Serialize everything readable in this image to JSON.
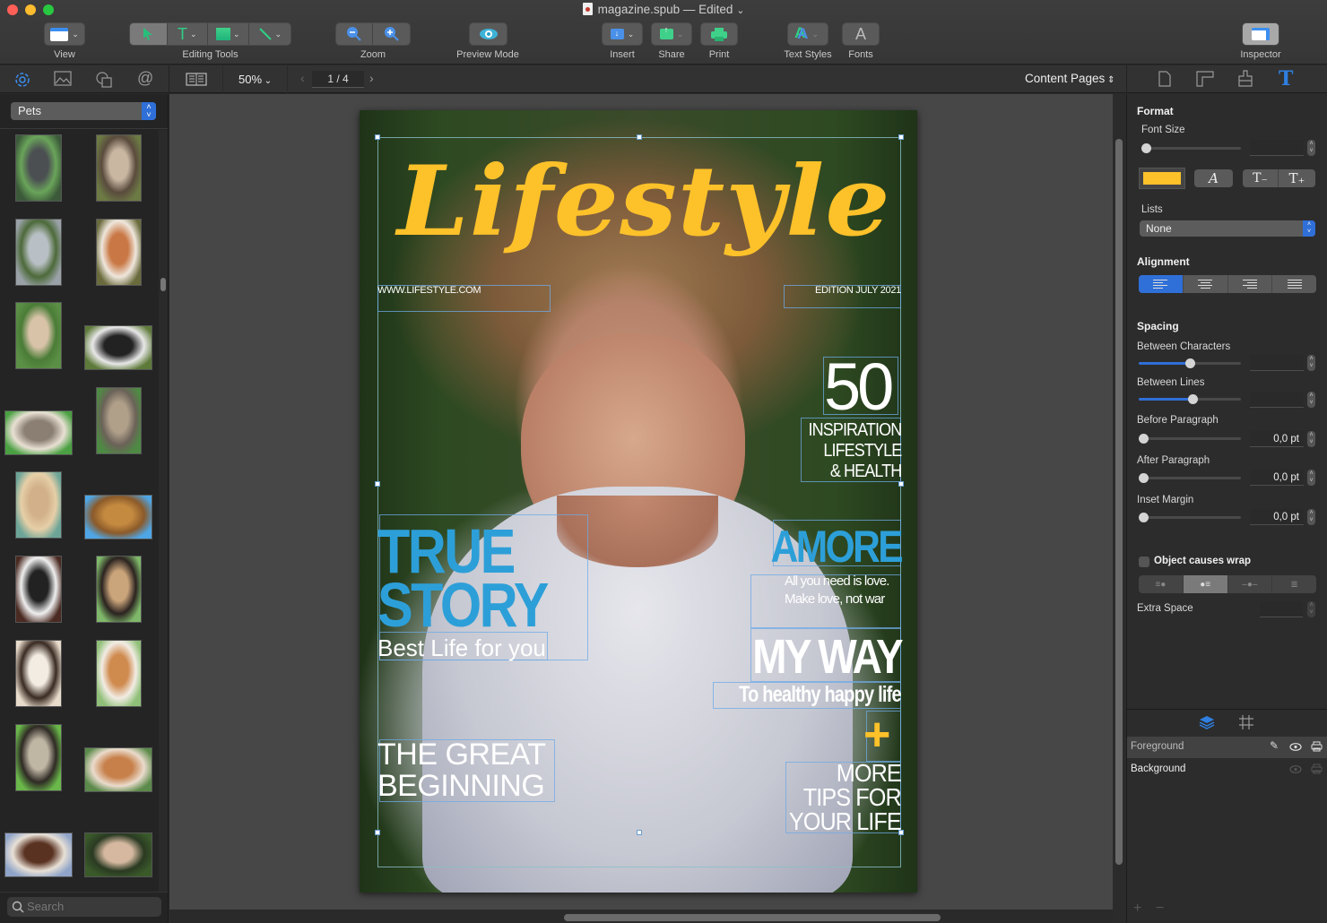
{
  "window": {
    "title": "magazine.spub — Edited",
    "title_chevron": "⌄"
  },
  "toolbar": {
    "view_label": "View",
    "editing_tools_label": "Editing Tools",
    "zoom_label": "Zoom",
    "preview_label": "Preview Mode",
    "insert_label": "Insert",
    "share_label": "Share",
    "print_label": "Print",
    "text_styles_label": "Text Styles",
    "fonts_label": "Fonts",
    "inspector_label": "Inspector",
    "fonts_glyph": "A",
    "text_styles_glyph": "A"
  },
  "subbar": {
    "zoom_value": "50%",
    "page_indicator": "1 / 4",
    "prev": "‹",
    "next": "›",
    "page_set": "Content Pages"
  },
  "library": {
    "category": "Pets",
    "search_placeholder": "Search",
    "thumbnails": [
      {
        "name": "mastiff",
        "colors": [
          "#3c5a3a",
          "#4b4f52",
          "#6aa45a"
        ]
      },
      {
        "name": "pekingese",
        "colors": [
          "#6c7a44",
          "#c9b7a2",
          "#5a4b3d"
        ]
      },
      {
        "name": "schnauzer",
        "colors": [
          "#9aa2a8",
          "#b9c0c5",
          "#4d6a3a"
        ]
      },
      {
        "name": "spaniel",
        "colors": [
          "#6a6b3d",
          "#c97845",
          "#efe6dc"
        ]
      },
      {
        "name": "whippet",
        "colors": [
          "#5c8f46",
          "#d8c3a8",
          "#4a7c37"
        ]
      },
      {
        "name": "newfoundland",
        "colors": [
          "#5e7a3a",
          "#222",
          "#e8e8e8"
        ]
      },
      {
        "name": "collie",
        "colors": [
          "#4aa042",
          "#8a7f72",
          "#e9e0d4"
        ]
      },
      {
        "name": "yorkie",
        "colors": [
          "#4e8a44",
          "#b0a08a",
          "#6b6258"
        ]
      },
      {
        "name": "briard",
        "colors": [
          "#6ca597",
          "#d2b18a",
          "#e6cfa8"
        ]
      },
      {
        "name": "airedale",
        "colors": [
          "#4ea6e6",
          "#c48a40",
          "#8b5a2a"
        ]
      },
      {
        "name": "husky",
        "colors": [
          "#4a2a22",
          "#222",
          "#efefef"
        ]
      },
      {
        "name": "bullmastiff",
        "colors": [
          "#7fb86a",
          "#caa47a",
          "#2b2320"
        ]
      },
      {
        "name": "samoyed",
        "colors": [
          "#e8dccc",
          "#f3ece2",
          "#3a2b22"
        ]
      },
      {
        "name": "shiba",
        "colors": [
          "#8fbf78",
          "#cf8a4e",
          "#f2ece4"
        ]
      },
      {
        "name": "weimaraner",
        "colors": [
          "#6ab84a",
          "#c0b6a4",
          "#2f2a25"
        ]
      },
      {
        "name": "setter",
        "colors": [
          "#5b8a4a",
          "#c7804a",
          "#eadbcc"
        ]
      },
      {
        "name": "springer",
        "colors": [
          "#8fa4c8",
          "#5a3222",
          "#e8e0d6"
        ]
      },
      {
        "name": "wheaten",
        "colors": [
          "#3a5a2a",
          "#d6b8a0",
          "#2a3a22"
        ]
      }
    ]
  },
  "cover": {
    "masthead": "Lifestyle",
    "website": "WWW.LIFESTYLE.COM",
    "edition": "EDITION JULY 2021",
    "number": "50",
    "inspiration_lines": [
      "INSPIRATION",
      "LIFESTYLE",
      "& HEALTH"
    ],
    "true_story_lines": [
      "TRUE",
      "STORY"
    ],
    "best_life": "Best Life for you",
    "amore": "AMORE",
    "amore_sub_lines": [
      "All you need is love.",
      "Make love, not war"
    ],
    "my_way": "MY WAY",
    "my_way_sub": "To healthy happy life",
    "plus": "+",
    "more_tips_lines": [
      "MORE",
      "TIPS FOR",
      "YOUR LIFE"
    ],
    "great_beginning_lines": [
      "THE GREAT",
      "BEGINNING"
    ],
    "colors": {
      "yellow": "#fdc12a",
      "blue": "#2d9fd8",
      "white": "#ffffff"
    }
  },
  "inspector": {
    "format_heading": "Format",
    "font_size_label": "Font Size",
    "font_size_value": "",
    "font_size_slider": 0,
    "text_color": "#fdc12a",
    "italic_glyph": "A",
    "decrease_glyph": "T₋",
    "increase_glyph": "T₊",
    "lists_label": "Lists",
    "lists_value": "None",
    "alignment_heading": "Alignment",
    "alignment_selected": "left",
    "spacing_heading": "Spacing",
    "between_characters_label": "Between Characters",
    "between_characters_slider": 0.5,
    "between_characters_value": "",
    "between_lines_label": "Between Lines",
    "between_lines_slider": 0.53,
    "between_lines_value": "",
    "before_paragraph_label": "Before Paragraph",
    "before_paragraph_value": "0,0 pt",
    "after_paragraph_label": "After Paragraph",
    "after_paragraph_value": "0,0 pt",
    "inset_margin_label": "Inset Margin",
    "inset_margin_value": "0,0 pt",
    "wrap_label": "Object causes wrap",
    "wrap_checked": false,
    "wrap_selected_index": 1,
    "extra_space_label": "Extra Space",
    "extra_space_value": ""
  },
  "layers": {
    "items": [
      {
        "name": "Foreground",
        "selected": true,
        "visible": true,
        "printable": true,
        "editable": true
      },
      {
        "name": "Background",
        "selected": false,
        "visible": true,
        "printable": true,
        "editable": false
      }
    ],
    "add_glyph": "+",
    "remove_glyph": "−"
  }
}
